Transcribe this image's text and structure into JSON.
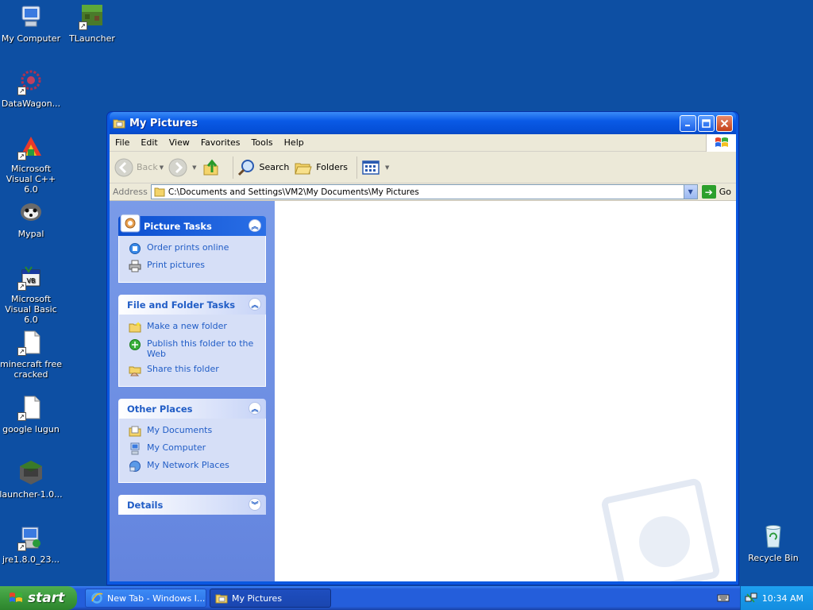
{
  "desktop": {
    "icons": [
      {
        "label": "My Computer"
      },
      {
        "label": "TLauncher"
      },
      {
        "label": "DataWagon..."
      },
      {
        "label": "Microsoft Visual C++ 6.0"
      },
      {
        "label": "Mypal"
      },
      {
        "label": "Microsoft Visual Basic 6.0"
      },
      {
        "label": "minecraft free cracked"
      },
      {
        "label": "google lugun"
      },
      {
        "label": "launcher-1.0..."
      },
      {
        "label": "jre1.8.0_23..."
      },
      {
        "label": "Recycle Bin"
      }
    ]
  },
  "window": {
    "title": "My Pictures",
    "menu": [
      "File",
      "Edit",
      "View",
      "Favorites",
      "Tools",
      "Help"
    ],
    "toolbar": {
      "back": "Back",
      "search": "Search",
      "folders": "Folders"
    },
    "address": {
      "label": "Address",
      "path": "C:\\Documents and Settings\\VM2\\My Documents\\My Pictures",
      "go": "Go"
    },
    "panels": {
      "picture_tasks": {
        "title": "Picture Tasks",
        "items": [
          "Order prints online",
          "Print pictures"
        ]
      },
      "file_folder_tasks": {
        "title": "File and Folder Tasks",
        "items": [
          "Make a new folder",
          "Publish this folder to the Web",
          "Share this folder"
        ]
      },
      "other_places": {
        "title": "Other Places",
        "items": [
          "My Documents",
          "My Computer",
          "My Network Places"
        ]
      },
      "details": {
        "title": "Details"
      }
    }
  },
  "taskbar": {
    "start": "start",
    "tasks": [
      "New Tab - Windows I...",
      "My Pictures"
    ],
    "clock": "10:34 AM"
  },
  "colors": {
    "desktop": "#0d4fa3",
    "link": "#215dc6",
    "start_green": "#3c9a3c"
  }
}
